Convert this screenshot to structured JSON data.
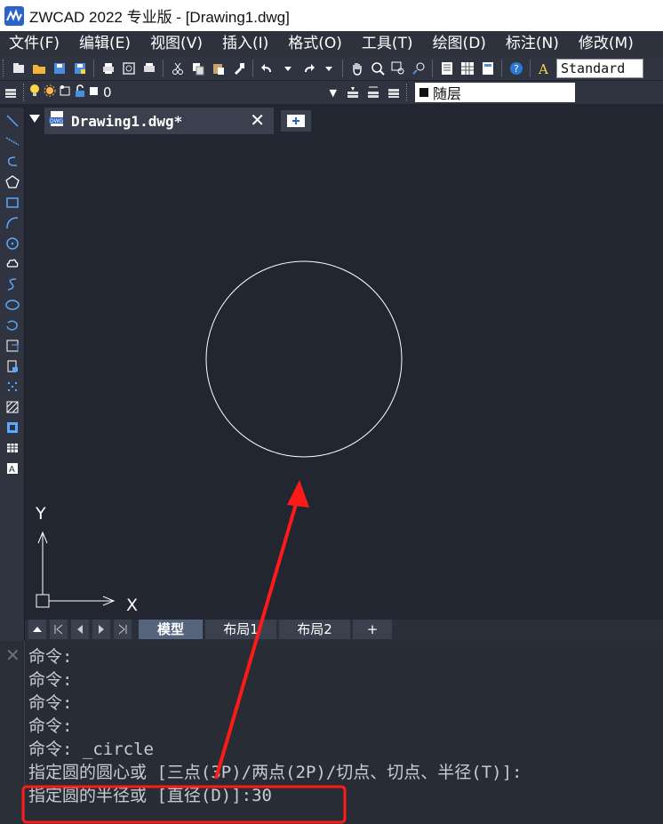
{
  "window": {
    "title": "ZWCAD 2022 专业版 - [Drawing1.dwg]"
  },
  "menu": {
    "items": [
      "文件(F)",
      "编辑(E)",
      "视图(V)",
      "插入(I)",
      "格式(O)",
      "工具(T)",
      "绘图(D)",
      "标注(N)",
      "修改(M)"
    ]
  },
  "toolbar": {
    "text_style": "Standard",
    "layer_name": "0",
    "color_label": "随层"
  },
  "document_tab": {
    "label": "Drawing1.dwg*",
    "close": "✕"
  },
  "canvas": {
    "ucs_y_label": "Y",
    "ucs_x_label": "X",
    "background_color": "#212630",
    "entity_color": "#ffffff"
  },
  "layout_tabs": {
    "model": "模型",
    "layout1": "布局1",
    "layout2": "布局2",
    "add": "+"
  },
  "command": {
    "close": "✕",
    "lines": [
      "命令:",
      "命令:",
      "命令:",
      "命令:",
      "命令: _circle",
      "指定圆的圆心或 [三点(3P)/两点(2P)/切点、切点、半径(T)]:",
      "指定圆的半径或 [直径(D)]:30"
    ]
  },
  "annotation": {
    "color": "#ff1a1a"
  }
}
